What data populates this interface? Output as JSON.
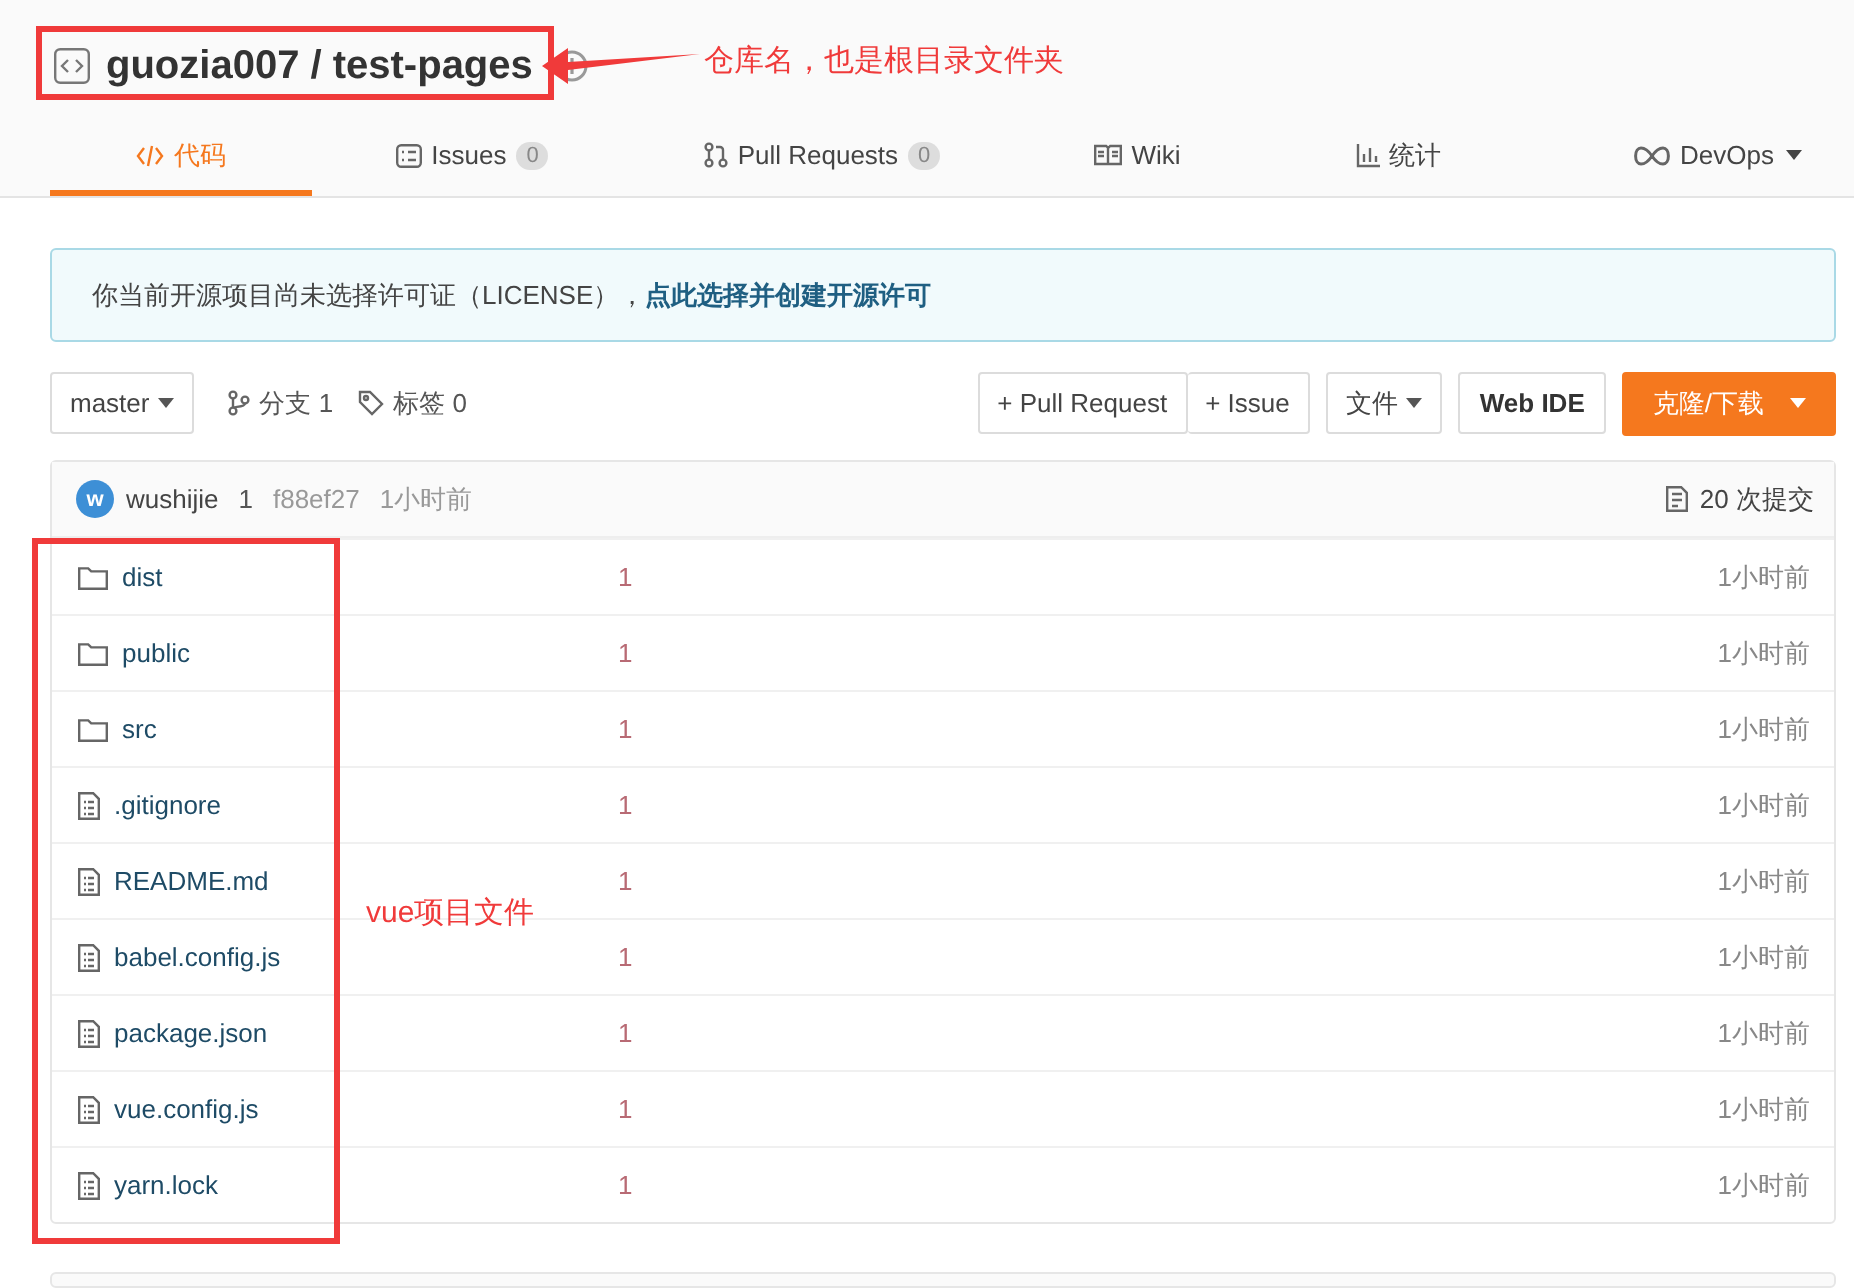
{
  "repo": {
    "owner": "guozia007",
    "separator": "/",
    "name": "test-pages"
  },
  "tabs": [
    {
      "label": "代码",
      "kind": "code",
      "selected": true
    },
    {
      "label": "Issues",
      "kind": "issues",
      "count": "0",
      "selected": false
    },
    {
      "label": "Pull Requests",
      "kind": "pr",
      "count": "0",
      "selected": false
    },
    {
      "label": "Wiki",
      "kind": "wiki",
      "selected": false
    },
    {
      "label": "统计",
      "kind": "stats",
      "selected": false
    },
    {
      "label": "DevOps",
      "kind": "devops",
      "dropdown": true,
      "selected": false
    }
  ],
  "notice": {
    "text": "你当前开源项目尚未选择许可证（LICENSE），",
    "link": "点此选择并创建开源许可"
  },
  "toolbar": {
    "branch": "master",
    "branches": "分支 1",
    "tags": "标签 0",
    "buttons": [
      {
        "label": "+ Pull Request",
        "kind": "group"
      },
      {
        "label": "+ Issue",
        "kind": "group"
      },
      {
        "label": "文件",
        "kind": "dropdown"
      },
      {
        "label": "Web IDE",
        "kind": "strong"
      },
      {
        "label": "克隆/下载",
        "kind": "primary"
      }
    ]
  },
  "commit": {
    "avatar": "w",
    "author": "wushijie",
    "message": "1",
    "hash": "f88ef27",
    "time": "1小时前",
    "count": "20 次提交"
  },
  "files": [
    {
      "kind": "folder",
      "name": "dist",
      "message": "1",
      "time": "1小时前"
    },
    {
      "kind": "folder",
      "name": "public",
      "message": "1",
      "time": "1小时前"
    },
    {
      "kind": "folder",
      "name": "src",
      "message": "1",
      "time": "1小时前"
    },
    {
      "kind": "file",
      "name": ".gitignore",
      "message": "1",
      "time": "1小时前"
    },
    {
      "kind": "file",
      "name": "README.md",
      "message": "1",
      "time": "1小时前"
    },
    {
      "kind": "file",
      "name": "babel.config.js",
      "message": "1",
      "time": "1小时前"
    },
    {
      "kind": "file",
      "name": "package.json",
      "message": "1",
      "time": "1小时前"
    },
    {
      "kind": "file",
      "name": "vue.config.js",
      "message": "1",
      "time": "1小时前"
    },
    {
      "kind": "file",
      "name": "yarn.lock",
      "message": "1",
      "time": "1小时前"
    }
  ],
  "annotations": [
    {
      "text": "仓库名，也是根目录文件夹",
      "kind": "title"
    },
    {
      "text": "vue项目文件",
      "kind": "files"
    }
  ]
}
